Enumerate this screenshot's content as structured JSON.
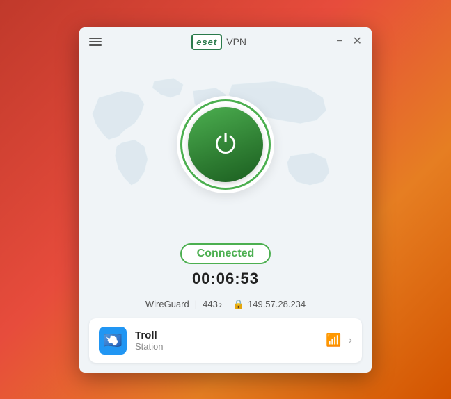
{
  "window": {
    "title": "VPN",
    "logo": "eset"
  },
  "titlebar": {
    "logo_text": "eset",
    "vpn_label": "VPN",
    "minimize_label": "−",
    "close_label": "✕"
  },
  "power_button": {
    "icon": "⏻"
  },
  "status": {
    "connected_label": "Connected",
    "timer": "00:06:53"
  },
  "connection": {
    "protocol": "WireGuard",
    "port": "443",
    "ip": "149.57.28.234"
  },
  "server": {
    "name": "Troll",
    "subtitle": "Station",
    "flag_emoji": "🇦🇶"
  }
}
